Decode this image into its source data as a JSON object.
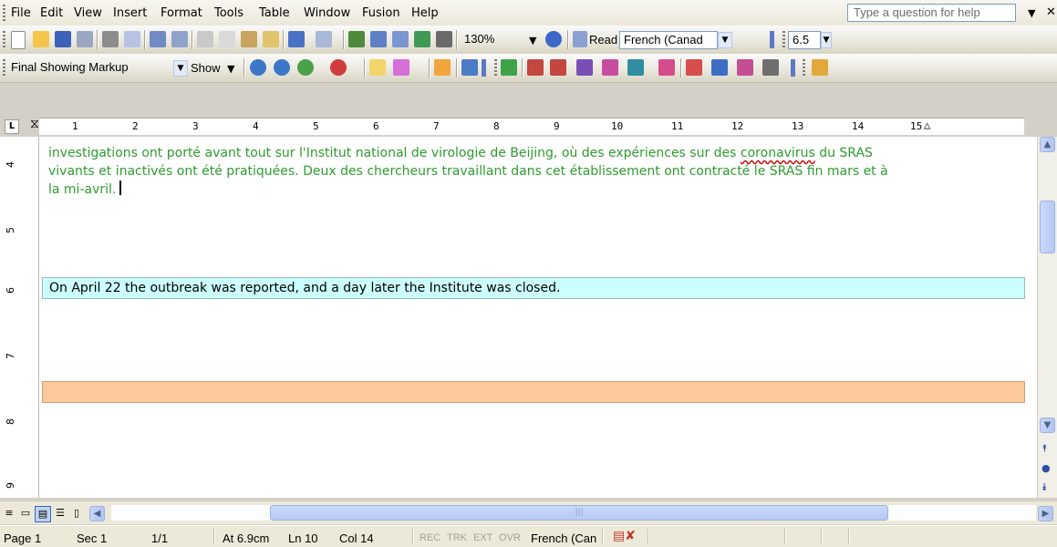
{
  "menu": {
    "items": [
      "File",
      "Edit",
      "View",
      "Insert",
      "Format",
      "Tools",
      "Table",
      "Window",
      "Fusion",
      "Help"
    ],
    "question_placeholder": "Type a question for help"
  },
  "standard_toolbar": {
    "zoom": "130%",
    "read_label": "Read",
    "language": "French (Canad",
    "font_size": "6.5"
  },
  "review_toolbar": {
    "display_mode": "Final Showing Markup",
    "show_label": "Show"
  },
  "ruler": {
    "numbers": [
      "1",
      "2",
      "3",
      "4",
      "5",
      "6",
      "7",
      "8",
      "9",
      "10",
      "11",
      "12",
      "13",
      "14",
      "15"
    ],
    "vertical_numbers": [
      "4",
      "5",
      "6",
      "7",
      "8",
      "9"
    ]
  },
  "document": {
    "french_line1": "investigations ont porté avant tout sur l'Institut national de virologie de Beijing, où des expériences sur des ",
    "french_misspelled": "coronavirus",
    "french_line1_end": " du SRAS",
    "french_line2": "vivants et inactivés ont été pratiquées. Deux des chercheurs travaillant dans cet établissement ont contracté le SRAS fin mars et à",
    "french_line3": "la mi-avril.",
    "english_segment": "On April 22 the outbreak was reported, and a day later the Institute was closed.",
    "colors": {
      "source_text": "#2f9b2f",
      "target_segment_bg": "#ccfeff",
      "empty_segment_bg": "#fcc99b"
    }
  },
  "status": {
    "page": "Page 1",
    "sec": "Sec 1",
    "pages": "1/1",
    "at": "At 6.9cm",
    "ln": "Ln 10",
    "col": "Col 14",
    "rec": "REC",
    "trk": "TRK",
    "ext": "EXT",
    "ovr": "OVR",
    "language": "French (Can"
  }
}
